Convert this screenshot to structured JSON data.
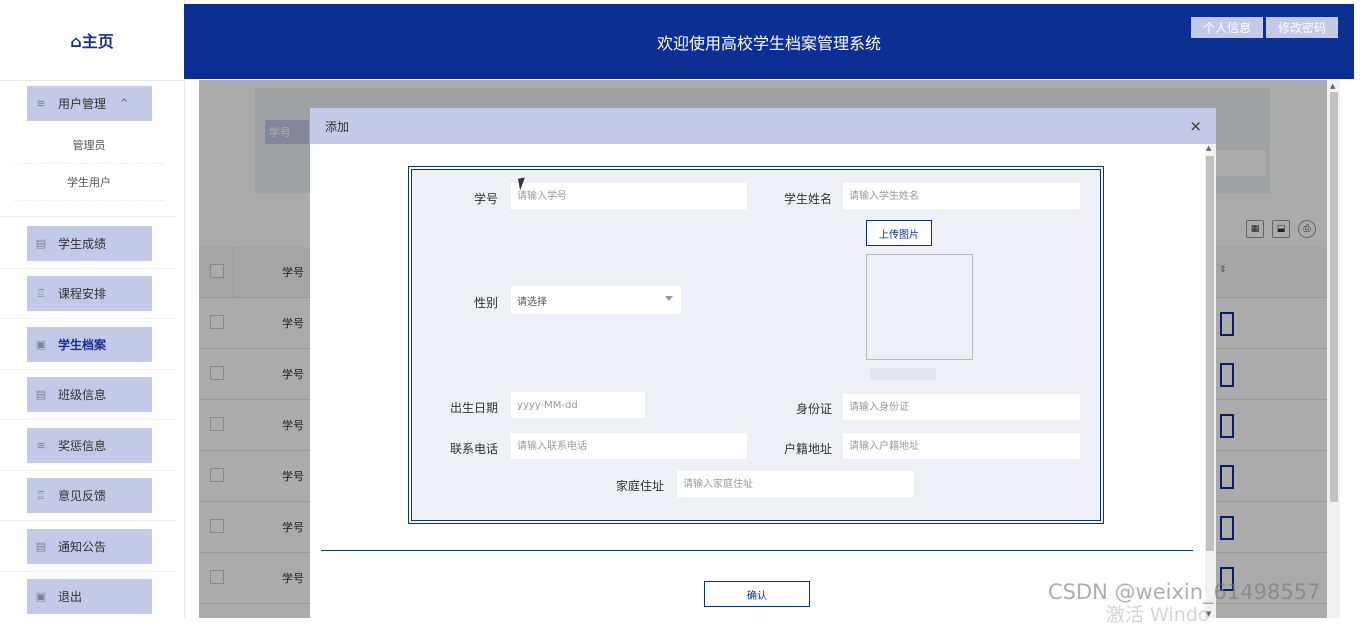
{
  "sidebar": {
    "home": {
      "icon": "home-icon",
      "label": "⌂主页"
    },
    "user_mgmt": {
      "label": "用户管理",
      "icon": "layers-icon",
      "caret": "^"
    },
    "sub_items": [
      "管理员",
      "学生用户"
    ],
    "items": [
      {
        "label": "学生成绩",
        "icon": "grid-icon"
      },
      {
        "label": "课程安排",
        "icon": "cup-icon"
      },
      {
        "label": "学生档案",
        "icon": "doc-icon",
        "active": true
      },
      {
        "label": "班级信息",
        "icon": "grid-icon"
      },
      {
        "label": "奖惩信息",
        "icon": "layers-icon"
      },
      {
        "label": "意见反馈",
        "icon": "cup-icon"
      },
      {
        "label": "通知公告",
        "icon": "grid-icon"
      },
      {
        "label": "退出",
        "icon": "doc-icon"
      }
    ]
  },
  "header": {
    "title": "欢迎使用高校学生档案管理系统",
    "profile_label": "个人信息",
    "password_label": "修改密码"
  },
  "main": {
    "search_label": "学号",
    "column_header": "学号",
    "rows": [
      "学号",
      "学号",
      "学号",
      "学号",
      "学号",
      "学号"
    ]
  },
  "modal": {
    "title": "添加",
    "close": "×",
    "fields": {
      "student_no": {
        "label": "学号",
        "placeholder": "请输入学号"
      },
      "student_name": {
        "label": "学生姓名",
        "placeholder": "请输入学生姓名"
      },
      "gender": {
        "label": "性别",
        "value": "请选择"
      },
      "upload": {
        "label": "上传图片"
      },
      "birth": {
        "label": "出生日期",
        "placeholder": "yyyy-MM-dd"
      },
      "id_card": {
        "label": "身份证",
        "placeholder": "请输入身份证"
      },
      "phone": {
        "label": "联系电话",
        "placeholder": "请输入联系电话"
      },
      "household": {
        "label": "户籍地址",
        "placeholder": "请输入户籍地址"
      },
      "home_addr": {
        "label": "家庭住址",
        "placeholder": "请输入家庭住址"
      }
    },
    "confirm_label": "确认"
  },
  "watermark": "CSDN @weixin_61498557",
  "watermark2": "激活 Windo",
  "colors": {
    "primary": "#0c2f94",
    "accent_light": "#c5c9e8",
    "form_bg": "#eef0f5"
  }
}
